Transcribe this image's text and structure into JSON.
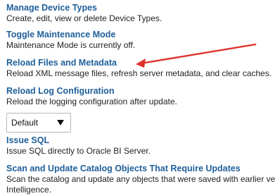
{
  "actions": [
    {
      "title": "Manage Device Types",
      "description": "Create, edit, view or delete Device Types."
    },
    {
      "title": "Toggle Maintenance Mode",
      "description": "Maintenance Mode is currently off."
    },
    {
      "title": "Reload Files and Metadata",
      "description": "Reload XML message files, refresh server metadata, and clear caches."
    },
    {
      "title": "Reload Log Configuration",
      "description": "Reload the logging configuration after update."
    },
    {
      "title": "Issue SQL",
      "description": "Issue SQL directly to Oracle BI Server."
    },
    {
      "title": "Scan and Update Catalog Objects That Require Updates",
      "description_line1": "Scan the catalog and update any objects that were saved with earlier ve",
      "description_line2": "Intelligence."
    }
  ],
  "log_config_select": {
    "selected": "Default"
  },
  "annotation": {
    "color": "#e0302a"
  }
}
